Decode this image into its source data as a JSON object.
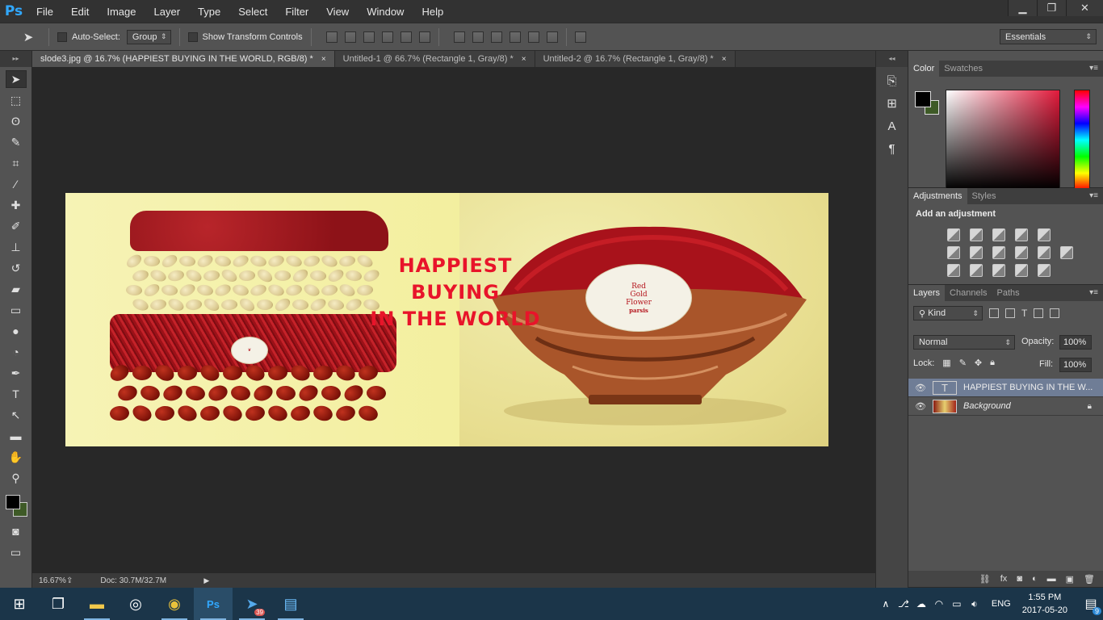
{
  "app": {
    "logo": "Ps"
  },
  "menu": [
    "File",
    "Edit",
    "Image",
    "Layer",
    "Type",
    "Select",
    "Filter",
    "View",
    "Window",
    "Help"
  ],
  "window_controls": {
    "minimize": "▁",
    "maximize": "❐",
    "close": "✕"
  },
  "options_bar": {
    "auto_select_label": "Auto-Select:",
    "auto_select_target": "Group",
    "show_transform_label": "Show Transform Controls",
    "workspace": "Essentials"
  },
  "tabs": [
    {
      "label": "slode3.jpg @ 16.7% (HAPPIEST  BUYING  IN THE WORLD, RGB/8) *",
      "close": "×",
      "active": true
    },
    {
      "label": "Untitled-1 @ 66.7% (Rectangle 1, Gray/8) *",
      "close": "×",
      "active": false
    },
    {
      "label": "Untitled-2 @ 16.7% (Rectangle 1, Gray/8) *",
      "close": "×",
      "active": false
    }
  ],
  "tools": [
    {
      "name": "move-tool-icon",
      "glyph": "➤"
    },
    {
      "name": "marquee-tool-icon",
      "glyph": "⬚"
    },
    {
      "name": "lasso-tool-icon",
      "glyph": "ʘ"
    },
    {
      "name": "quick-selection-tool-icon",
      "glyph": "✎"
    },
    {
      "name": "crop-tool-icon",
      "glyph": "⌗"
    },
    {
      "name": "eyedropper-tool-icon",
      "glyph": "⁄"
    },
    {
      "name": "healing-brush-tool-icon",
      "glyph": "✚"
    },
    {
      "name": "brush-tool-icon",
      "glyph": "✐"
    },
    {
      "name": "clone-stamp-tool-icon",
      "glyph": "⊥"
    },
    {
      "name": "history-brush-tool-icon",
      "glyph": "↺"
    },
    {
      "name": "eraser-tool-icon",
      "glyph": "▰"
    },
    {
      "name": "gradient-tool-icon",
      "glyph": "▭"
    },
    {
      "name": "blur-tool-icon",
      "glyph": "●"
    },
    {
      "name": "dodge-tool-icon",
      "glyph": "◔"
    },
    {
      "name": "pen-tool-icon",
      "glyph": "✒"
    },
    {
      "name": "type-tool-icon",
      "glyph": "T"
    },
    {
      "name": "path-selection-tool-icon",
      "glyph": "↖"
    },
    {
      "name": "rectangle-tool-icon",
      "glyph": "▬"
    },
    {
      "name": "hand-tool-icon",
      "glyph": "✋"
    },
    {
      "name": "zoom-tool-icon",
      "glyph": "⚲"
    }
  ],
  "canvas": {
    "headline": [
      "HAPPIEST",
      "BUYING",
      "IN THE  WORLD"
    ],
    "label_right": [
      "Red",
      "Gold",
      "Flower",
      "parsis"
    ]
  },
  "status": {
    "zoom": "16.67%",
    "doc": "Doc: 30.7M/32.7M"
  },
  "color_panel": {
    "tabs": [
      "Color",
      "Swatches"
    ],
    "foreground": "#000000",
    "background": "#3e5a27"
  },
  "adjustments_panel": {
    "tabs": [
      "Adjustments",
      "Styles"
    ],
    "title": "Add an adjustment"
  },
  "layers_panel": {
    "tabs": [
      "Layers",
      "Channels",
      "Paths"
    ],
    "kind": "Kind",
    "blend_mode": "Normal",
    "opacity_label": "Opacity:",
    "opacity": "100%",
    "lock_label": "Lock:",
    "fill_label": "Fill:",
    "fill": "100%",
    "layers": [
      {
        "name": "HAPPIEST  BUYING  IN THE W...",
        "type": "text",
        "selected": true
      },
      {
        "name": "Background",
        "type": "image",
        "selected": false,
        "locked": true
      }
    ]
  },
  "taskbar": {
    "language": "ENG",
    "time": "1:55 PM",
    "date": "2017-05-20",
    "telegram_badge": "39",
    "notification_count": "9"
  }
}
